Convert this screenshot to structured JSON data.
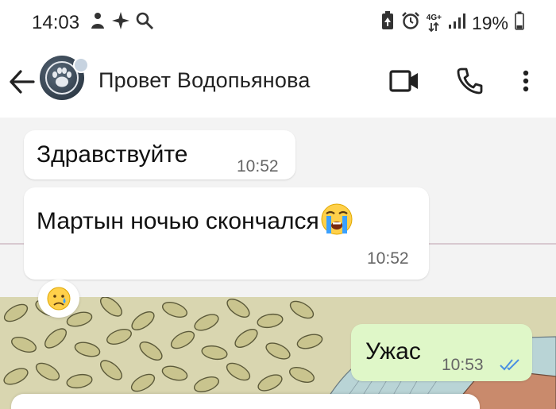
{
  "status_bar": {
    "time": "14:03",
    "network": "4G+",
    "battery": "19%",
    "left_icons": [
      "person-icon",
      "sparkle-icon",
      "search-icon"
    ],
    "right_icons": [
      "battery-saver-icon",
      "alarm-icon",
      "network-icon",
      "signal-icon",
      "battery-icon"
    ]
  },
  "header": {
    "contact_name": "Провет Водопьянова",
    "icons": [
      "back-arrow-icon",
      "video-call-icon",
      "phone-icon",
      "more-vert-icon"
    ]
  },
  "messages": [
    {
      "direction": "incoming",
      "text": "Здравствуйте",
      "time": "10:52"
    },
    {
      "direction": "incoming",
      "text": "Мартын ночью скончался",
      "emoji": "crying-face",
      "time": "10:52"
    },
    {
      "direction": "outgoing",
      "text": "Ужас",
      "time": "10:53",
      "status": "read"
    }
  ],
  "reaction": {
    "emoji": "sad-tear-face"
  },
  "colors": {
    "outgoing_bubble": "#dff7c8",
    "incoming_bubble": "#ffffff",
    "read_ticks": "#4a90e2",
    "chat_background": "#f3f3f3"
  }
}
